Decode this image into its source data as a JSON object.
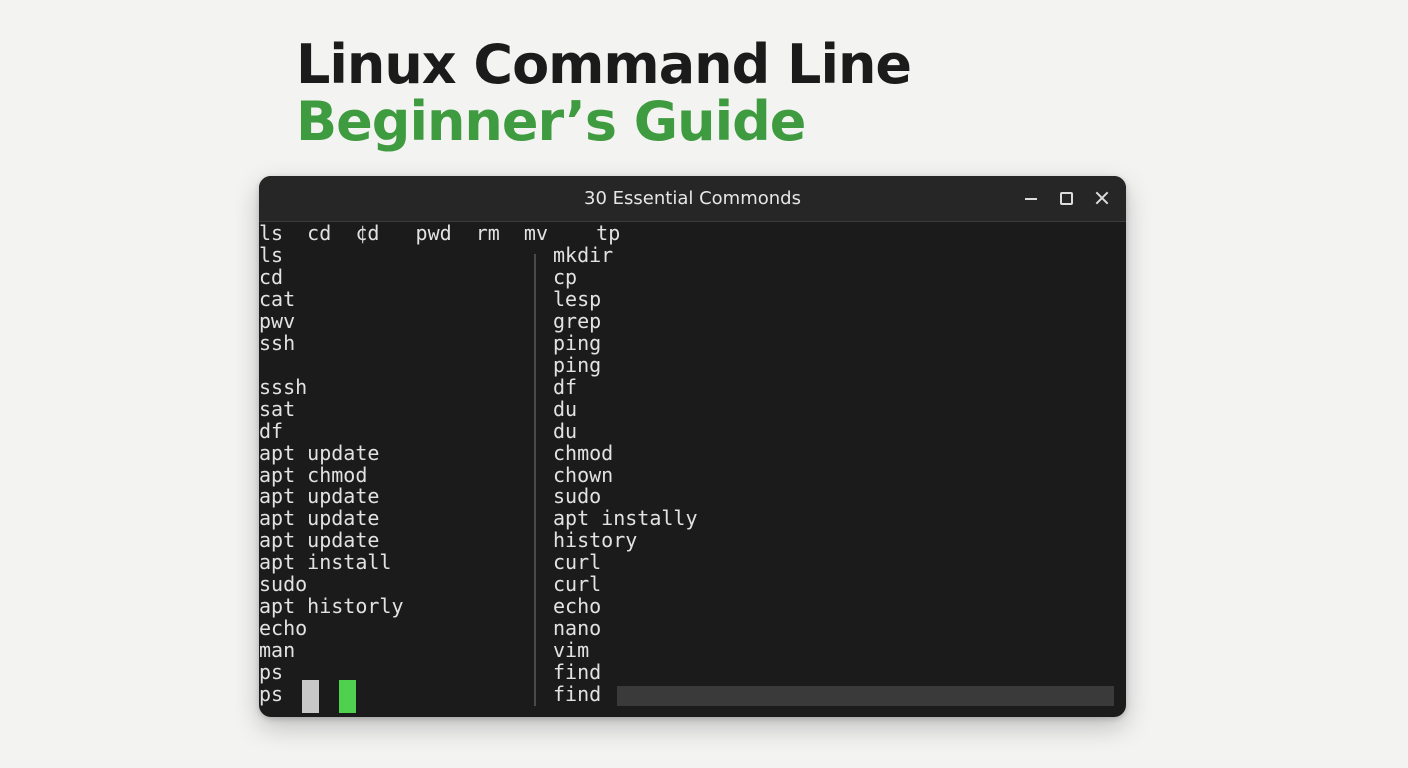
{
  "heading": {
    "line1": "Linux Command Line",
    "line2": "Beginner’s Guide"
  },
  "colors": {
    "heading_dark": "#1b1b1b",
    "heading_accent": "#3f9b3f",
    "terminal_bg": "#1b1b1b",
    "cursor_green": "#4fd14f",
    "cursor_gray": "#c8c8c8"
  },
  "window": {
    "title": "30 Essential Commonds",
    "controls": [
      "minimize-icon",
      "maximize-icon",
      "close-icon"
    ]
  },
  "terminal": {
    "header_line": "ls  cd  ¢d   pwd  rm  mv    tp",
    "left_lines": [
      "ls",
      "cd",
      "cat",
      "pwv",
      "ssh",
      "",
      "sssh",
      "sat",
      "df",
      "apt update",
      "apt chmod",
      "apt update",
      "apt update",
      "apt update",
      "apt install",
      "sudo",
      "apt historly",
      "echo",
      "man",
      "ps",
      "ps"
    ],
    "right_lines": [
      "mkdir",
      "cp",
      "lesp",
      "grep",
      "ping",
      "ping",
      "df",
      "du",
      "du",
      "chmod",
      "chown",
      "sudo",
      "apt instally",
      "history",
      "curl",
      "curl",
      "echo",
      "nano",
      "vim",
      "find",
      "find"
    ]
  }
}
